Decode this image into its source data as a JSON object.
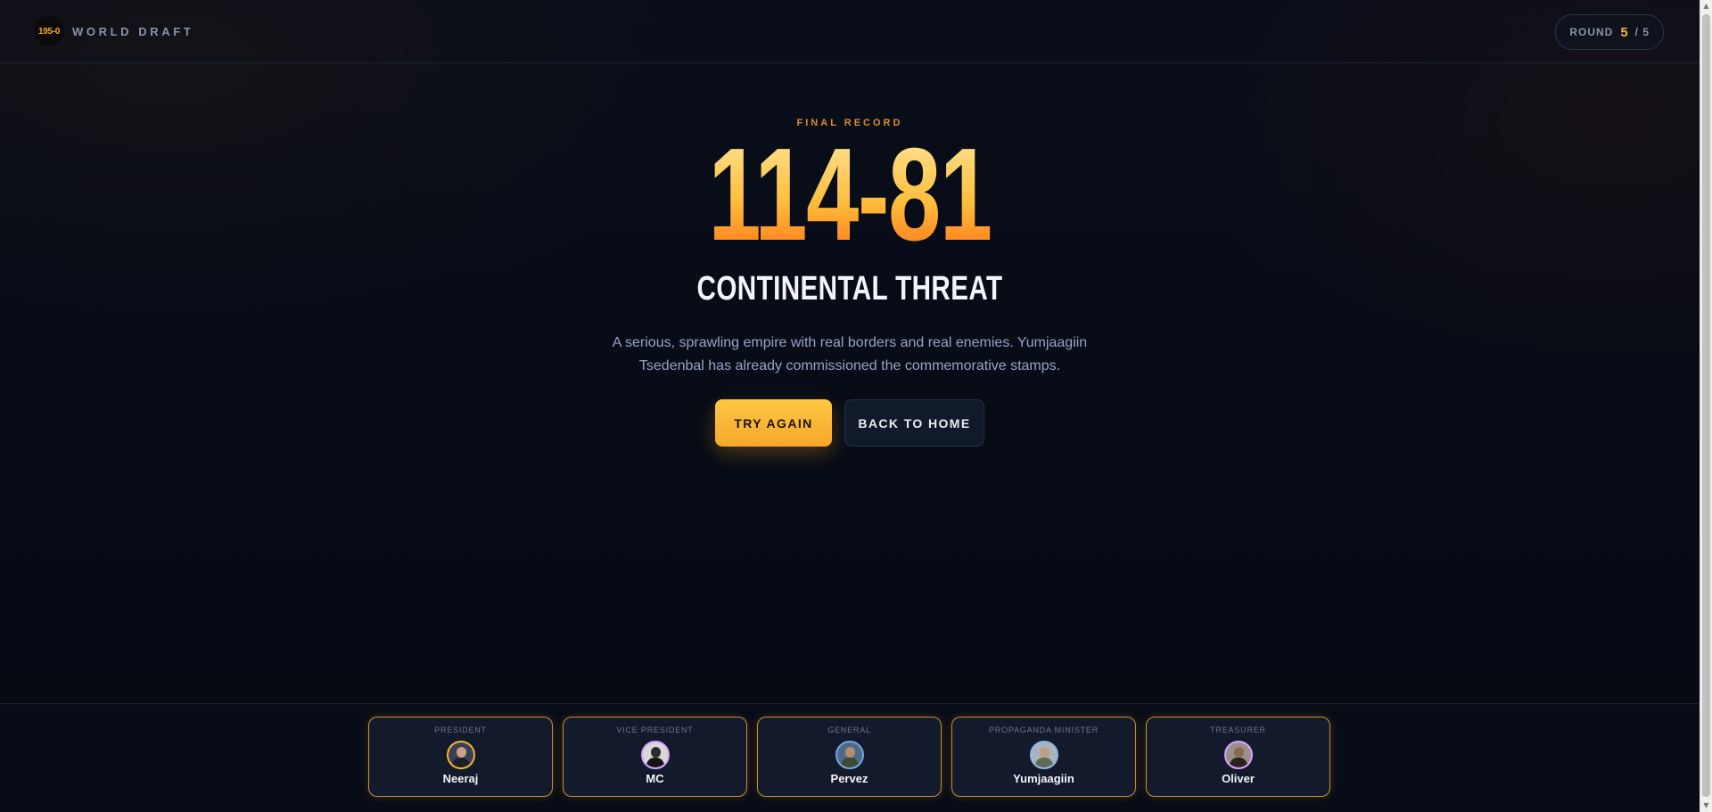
{
  "header": {
    "brand_badge": "195-0",
    "brand_name": "WORLD DRAFT",
    "round_label": "ROUND",
    "round_current": "5",
    "round_total": "/ 5"
  },
  "result": {
    "eyebrow": "FINAL RECORD",
    "record": "114-81",
    "tier": "CONTINENTAL THREAT",
    "description": "A serious, sprawling empire with real borders and real enemies. Yumjaagiin Tsedenbal has already commissioned the commemorative stamps."
  },
  "actions": {
    "try_again": "TRY AGAIN",
    "back_home": "BACK TO HOME"
  },
  "cabinet": [
    {
      "role": "PRESIDENT",
      "name": "Neeraj",
      "ring": "#f6b532",
      "bg": "#3a3f55",
      "skin": "#c9a089",
      "suit": "#1b1f2b"
    },
    {
      "role": "VICE PRESIDENT",
      "name": "MC",
      "ring": "#d7a3ff",
      "bg": "#d8d8d8",
      "skin": "#2b2b2b",
      "suit": "#141414"
    },
    {
      "role": "GENERAL",
      "name": "Pervez",
      "ring": "#6fa8dc",
      "bg": "#4d6a8a",
      "skin": "#b88c6a",
      "suit": "#3d4a33"
    },
    {
      "role": "PROPAGANDA MINISTER",
      "name": "Yumjaagiin",
      "ring": "#8fb7e0",
      "bg": "#a8b3c2",
      "skin": "#c39b7e",
      "suit": "#5f6b52"
    },
    {
      "role": "TREASURER",
      "name": "Oliver",
      "ring": "#d7a3ff",
      "bg": "#9a8f86",
      "skin": "#8a6a52",
      "suit": "#2a2220"
    }
  ]
}
